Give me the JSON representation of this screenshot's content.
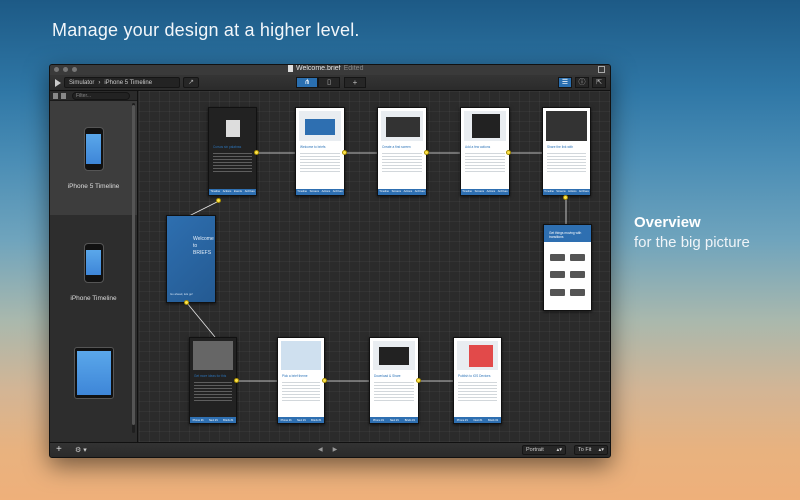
{
  "headline": "Manage your design at a higher level.",
  "side_caption": {
    "title": "Overview",
    "subtitle": "for the big picture"
  },
  "window": {
    "title": "Welcome.brief",
    "status": "Edited",
    "scheme": {
      "target": "Simulator",
      "separator": "›",
      "timeline": "iPhone 5 Timeline"
    },
    "toolbar": {
      "add": "+",
      "share": "↗"
    },
    "filter_placeholder": "Filter...",
    "devices": [
      {
        "label": "iPhone 5 Timeline",
        "selected": true
      },
      {
        "label": "iPhone Timeline",
        "selected": false
      },
      {
        "label": "",
        "selected": false
      }
    ],
    "bottom": {
      "add": "+",
      "gear": "⚙ ▾",
      "prev": "◀",
      "next": "▶",
      "orientation": "Portrait",
      "zoom": "To Fit",
      "dropdown": "▴▾"
    }
  },
  "cards": [
    {
      "id": "c1",
      "title": "Cursos sin palabras",
      "tabs": [
        "Timeline",
        "Actions",
        "Events",
        "Archives"
      ]
    },
    {
      "id": "c2",
      "title": "Welcome to briefs",
      "tabs": [
        "Timeline",
        "Screens",
        "Actions",
        "Archives"
      ]
    },
    {
      "id": "c3",
      "title": "Create a first screen",
      "tabs": [
        "Timeline",
        "Screens",
        "Actions",
        "Archives"
      ]
    },
    {
      "id": "c4",
      "title": "Add a few actions",
      "tabs": [
        "Timeline",
        "Screens",
        "Actions",
        "Archives"
      ]
    },
    {
      "id": "c5",
      "title": "Share the link with",
      "tabs": [
        "Timeline",
        "Screens",
        "Actions",
        "Archives"
      ]
    },
    {
      "id": "c6",
      "brand": "Welcome\nto\nBRIEFS",
      "foot": "Go ahead, lets go!"
    },
    {
      "id": "c7",
      "title": "Get things moving with transitions"
    },
    {
      "id": "c8",
      "title": "Get more ideas for this",
      "tabs": [
        "Phone #1",
        "Next #1",
        "Briefs #1"
      ]
    },
    {
      "id": "c9",
      "title": "Pick a brief theme",
      "tabs": [
        "Phone #1",
        "Next #1",
        "Briefs #1"
      ]
    },
    {
      "id": "c10",
      "title": "Download & Share",
      "tabs": [
        "Phone #1",
        "Next #1",
        "Briefs #1"
      ]
    },
    {
      "id": "c11",
      "title": "Publish to iOS Devices",
      "tabs": [
        "Phone #1",
        "Next #1",
        "Briefs #1"
      ]
    }
  ]
}
